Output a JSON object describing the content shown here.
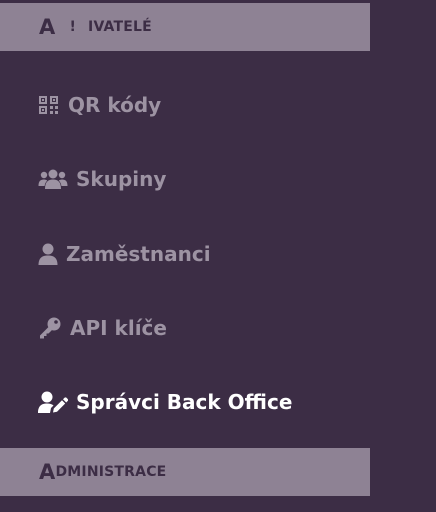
{
  "sidebar": {
    "section_users": {
      "part_a": "A",
      "part_b": "!",
      "part_c": "IVATELÉ"
    },
    "items": [
      {
        "label": "QR kódy",
        "icon": "qr-code-icon",
        "active": false
      },
      {
        "label": "Skupiny",
        "icon": "users-group-icon",
        "active": false
      },
      {
        "label": "Zaměstnanci",
        "icon": "user-icon",
        "active": false
      },
      {
        "label": "API klíče",
        "icon": "key-icon",
        "active": false
      },
      {
        "label": "Správci Back Office",
        "icon": "user-edit-icon",
        "active": true
      }
    ],
    "section_admin": {
      "first_letter": "A",
      "rest": "DMINISTRACE"
    }
  },
  "colors": {
    "background": "#3c2d45",
    "header_bg": "#8e8294",
    "item_text": "#9d93a3",
    "active_text": "#ffffff"
  }
}
